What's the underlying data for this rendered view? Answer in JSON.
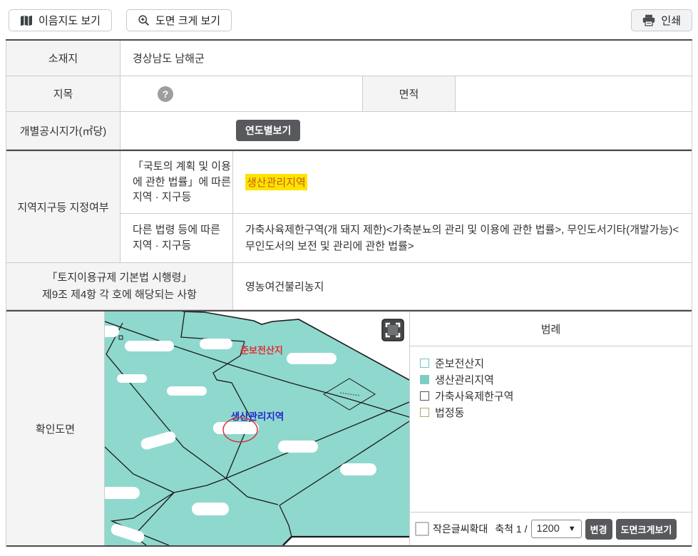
{
  "toolbar": {
    "eum_map_label": "이음지도 보기",
    "enlarge_view_label": "도면 크게 보기",
    "print_label": "인쇄"
  },
  "icons": {
    "help": "?"
  },
  "info": {
    "location": {
      "label": "소재지",
      "value": "경상남도 남해군"
    },
    "land_category": {
      "label": "지목"
    },
    "area": {
      "label": "면적"
    },
    "official_price": {
      "label": "개별공시지가(㎡당)",
      "year_button_label": "연도별보기"
    },
    "zone_designation": {
      "label": "지역지구등 지정여부",
      "national_law": {
        "label": "「국토의 계획 및 이용\n에 관한 법률」에 따른\n지역 · 지구등",
        "value": "생산관리지역"
      },
      "other_laws": {
        "label": "다른 법령 등에 따른\n지역 · 지구등",
        "value": "가축사육제한구역(개 돼지 제한)<가축분뇨의 관리 및 이용에 관한 법률>, 무인도서기타(개발가능)<무인도서의 보전 및 관리에 관한 법률>"
      }
    },
    "enforcement_decree": {
      "label": "「토지이용규제 기본법 시행령」\n제9조 제4항 각 호에 해당되는 사항",
      "value": "영농여건불리농지"
    }
  },
  "map_section": {
    "label": "확인도면",
    "map_labels": {
      "red": "준보전산지",
      "blue": "생산관리지역"
    },
    "colors": {
      "map_fill": "#8fd8ce",
      "red_label": "#e03131",
      "blue_label": "#2525cd",
      "highlight_bg": "#ffe400"
    },
    "legend": {
      "title": "범례",
      "items": [
        {
          "label": "준보전산지",
          "style": "background:#ffffff;border:1px solid #6ec6bc"
        },
        {
          "label": "생산관리지역",
          "style": "background:#7fccc3;border:1px solid #7fccc3"
        },
        {
          "label": "가축사육제한구역",
          "style": "background:#ffffff;border:1px solid #555555"
        },
        {
          "label": "법정동",
          "style": "background:#ffffff;border:1px solid #b5a478"
        }
      ]
    },
    "controls": {
      "small_text_label": "작은글씨확대",
      "scale_prefix": "축척 1 /",
      "scale_value": "1200",
      "change_label": "변경",
      "enlarge_drawing_label": "도면크게보기"
    }
  }
}
